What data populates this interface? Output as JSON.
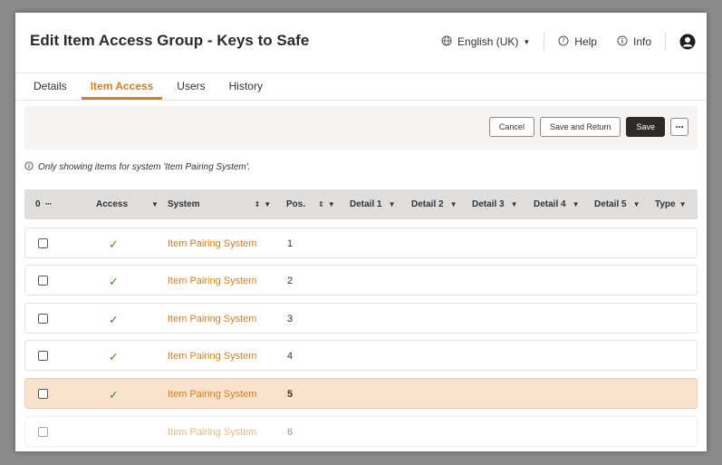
{
  "header": {
    "title": "Edit Item Access Group - Keys to Safe",
    "language": "English (UK)",
    "help": "Help",
    "info": "Info"
  },
  "tabs": [
    {
      "label": "Details",
      "active": false
    },
    {
      "label": "Item Access",
      "active": true
    },
    {
      "label": "Users",
      "active": false
    },
    {
      "label": "History",
      "active": false
    }
  ],
  "toolbar": {
    "cancel": "Cancel",
    "save_and_return": "Save and Return",
    "save": "Save",
    "more": "···"
  },
  "notice": "Only showing items for system 'Item Pairing System'.",
  "table": {
    "selected_count": "0",
    "select_menu": "···",
    "columns": {
      "access": "Access",
      "system": "System",
      "pos": "Pos.",
      "detail1": "Detail 1",
      "detail2": "Detail 2",
      "detail3": "Detail 3",
      "detail4": "Detail 4",
      "detail5": "Detail 5",
      "type": "Type"
    },
    "rows": [
      {
        "access": "✓",
        "system": "Item Pairing System",
        "pos": "1",
        "highlighted": false
      },
      {
        "access": "✓",
        "system": "Item Pairing System",
        "pos": "2",
        "highlighted": false
      },
      {
        "access": "✓",
        "system": "Item Pairing System",
        "pos": "3",
        "highlighted": false
      },
      {
        "access": "✓",
        "system": "Item Pairing System",
        "pos": "4",
        "highlighted": false
      },
      {
        "access": "✓",
        "system": "Item Pairing System",
        "pos": "5",
        "highlighted": true
      },
      {
        "access": "",
        "system": "Item Pairing System",
        "pos": "6",
        "highlighted": false
      }
    ]
  },
  "colors": {
    "accent": "#d57f25",
    "check": "#3c8c1e",
    "highlight_row": "#fbe2cc",
    "header_row": "#e0dedc",
    "dark_button": "#2f2a26"
  }
}
